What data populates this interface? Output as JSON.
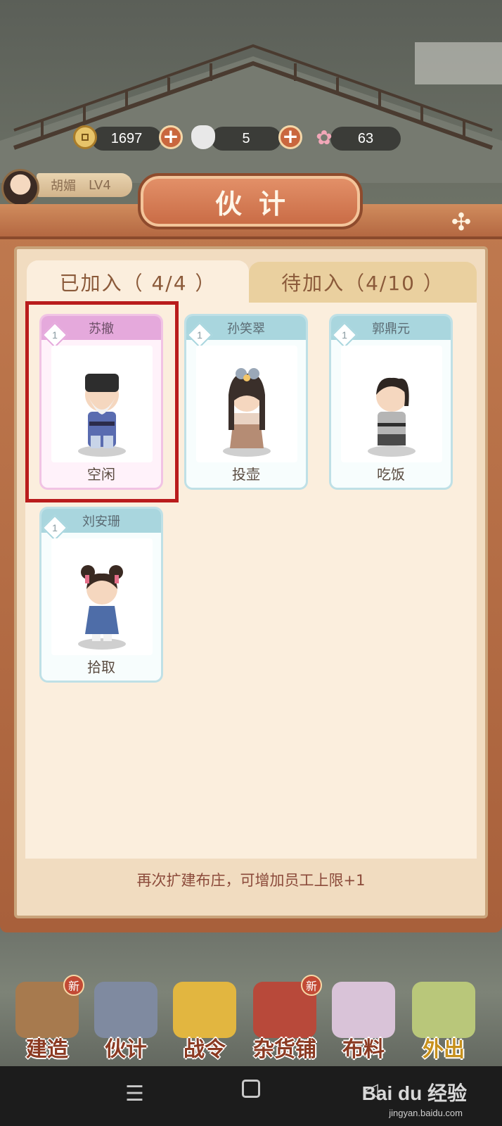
{
  "currency": {
    "coins": "1697",
    "silver": "5",
    "flowers": "63"
  },
  "player": {
    "name": "胡媚",
    "level": "LV4"
  },
  "dialog": {
    "title": "伙计",
    "tabs": [
      {
        "label": "已加入（ 4/4 ）",
        "active": true
      },
      {
        "label": "待加入（4/10 ）",
        "active": false
      }
    ],
    "workers": [
      {
        "name": "苏撤",
        "level": "1",
        "status": "空闲",
        "theme": "pink",
        "highlighted": true
      },
      {
        "name": "孙笑翠",
        "level": "1",
        "status": "投壶",
        "theme": "blue"
      },
      {
        "name": "郭鼎元",
        "level": "1",
        "status": "吃饭",
        "theme": "blue"
      },
      {
        "name": "刘安珊",
        "level": "1",
        "status": "拾取",
        "theme": "blue"
      }
    ],
    "footer_note": "再次扩建布庄，可增加员工上限+1"
  },
  "menu": [
    {
      "label": "建造",
      "badge": "新",
      "icon": "build-icon"
    },
    {
      "label": "伙计",
      "icon": "workers-icon"
    },
    {
      "label": "战令",
      "icon": "battle-pass-icon"
    },
    {
      "label": "杂货铺",
      "badge": "新",
      "icon": "shop-icon"
    },
    {
      "label": "布料",
      "icon": "fabric-icon"
    },
    {
      "label": "外出",
      "icon": "outing-icon"
    }
  ],
  "watermark": {
    "brand": "Bai du 经验",
    "url": "jingyan.baidu.com"
  }
}
